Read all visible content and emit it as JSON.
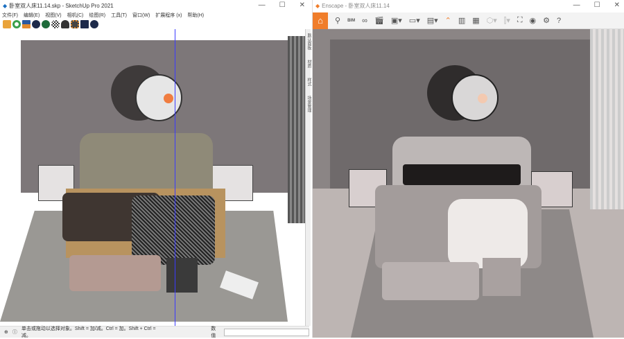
{
  "sketchup": {
    "title": "卧室双人床11.14.skp - SketchUp Pro 2021",
    "window_buttons": [
      "—",
      "☐",
      "✕"
    ],
    "menu": [
      "文件(F)",
      "编辑(E)",
      "视图(V)",
      "相机(C)",
      "绘图(R)",
      "工具(T)",
      "窗口(W)",
      "扩展程序 (x)",
      "帮助(H)"
    ],
    "toolbar_icons": [
      "warehouse-icon",
      "refresh-icon",
      "layers-icon",
      "add-icon",
      "tree-icon",
      "pattern-icon",
      "cloud-upload-icon",
      "gear-icon",
      "mail-icon",
      "info-icon"
    ],
    "side_tabs": [
      "默认面板",
      "材质",
      "样式",
      "场景管理"
    ],
    "status": {
      "message": "单击或拖动以选择对象。Shift = 加/减。Ctrl = 加。Shift + Ctrl = 减。",
      "measure_label": "数值",
      "measure_value": ""
    },
    "colors": {
      "wall": "#7d7779",
      "rug": "#9a9894",
      "bed_frame": "#b8935f"
    }
  },
  "enscape": {
    "title": "Enscape - 卧室双人床11.14",
    "window_buttons": [
      "—",
      "☐",
      "✕"
    ],
    "toolbar": [
      "home-icon",
      "location-icon",
      "bim-icon",
      "binoculars-icon",
      "clapper-icon",
      "screenshot-icon",
      "panorama-icon",
      "export-icon",
      "collapse-icon",
      "map-icon",
      "monitor-icon",
      "cube-icon",
      "book-icon",
      "vr-icon",
      "eye-icon",
      "settings-icon",
      "help-icon"
    ],
    "bim_label": "BIM",
    "accent": "#f07d2a"
  }
}
